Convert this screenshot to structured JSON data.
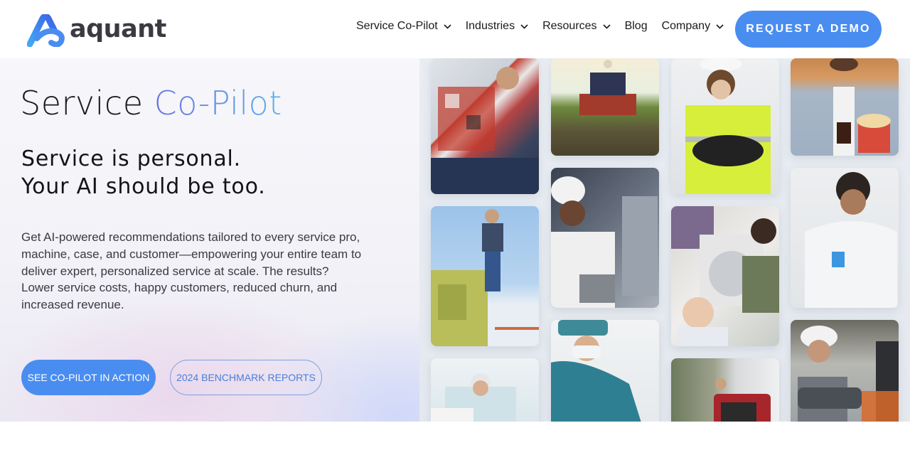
{
  "brand": {
    "name": "aquant",
    "colors": {
      "primary": "#4a8df0",
      "text": "#1b1b1f",
      "logo_text": "#3a3a42"
    }
  },
  "nav": {
    "items": [
      {
        "label": "Service Co-Pilot",
        "has_dropdown": true
      },
      {
        "label": "Industries",
        "has_dropdown": true
      },
      {
        "label": "Resources",
        "has_dropdown": true
      },
      {
        "label": "Blog",
        "has_dropdown": false
      },
      {
        "label": "Company",
        "has_dropdown": true
      }
    ],
    "cta_label": "REQUEST A DEMO"
  },
  "hero": {
    "title_plain": "Service",
    "title_accent": "Co-Pilot",
    "subtitle_line1": "Service is personal.",
    "subtitle_line2": "Your AI should be too.",
    "description": "Get AI-powered recommendations tailored to every service pro, machine, case, and customer—empowering your entire team to deliver expert, personalized service at scale. The results? Lower service costs, happy customers, reduced churn, and increased revenue.",
    "primary_button": "SEE CO-PILOT IN ACTION",
    "secondary_button": "2024 BENCHMARK REPORTS"
  },
  "photos": [
    {
      "subject": "technician-plaid-shirt"
    },
    {
      "subject": "farmer-tractor"
    },
    {
      "subject": "worker-hi-vis-jacket"
    },
    {
      "subject": "man-popcorn-drink"
    },
    {
      "subject": "man-on-machinery"
    },
    {
      "subject": "chef-kitchen"
    },
    {
      "subject": "family-washing-machine"
    },
    {
      "subject": "scientist-lab-coat"
    },
    {
      "subject": "senior-woman-patient"
    },
    {
      "subject": "surgeon-scrubs"
    },
    {
      "subject": "generator-outdoors"
    },
    {
      "subject": "woman-hard-hat-warehouse"
    }
  ]
}
